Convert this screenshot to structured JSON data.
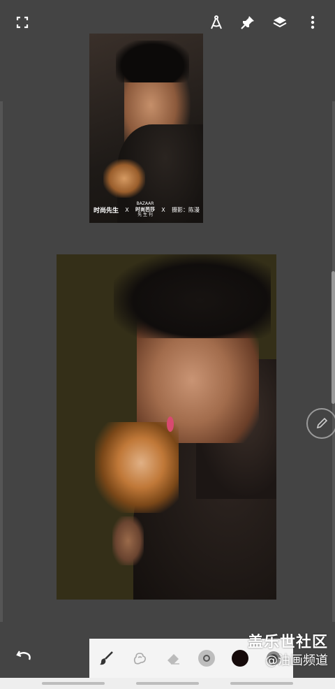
{
  "app": {
    "bg_color": "#444444"
  },
  "top_toolbar": {
    "icons": [
      "fullscreen-icon",
      "compass-icon",
      "pin-icon",
      "layers-icon",
      "more-icon"
    ]
  },
  "reference_image": {
    "caption_left": "时尚先生",
    "caption_x1": "X",
    "caption_mid_top": "BAZAAR",
    "caption_mid": "时尚芭莎",
    "caption_mid_sub": "先 生 刊",
    "caption_x2": "X",
    "caption_right": "摄影：陈漫"
  },
  "bottom_toolbar": {
    "tools": [
      "brush-icon",
      "smudge-icon",
      "eraser-icon",
      "brush-size-icon"
    ],
    "current_color": "#160b0b",
    "opacity_icon": "opacity-icon"
  },
  "watermark": {
    "line1": "盖乐世社区",
    "line2": "@油画频道"
  }
}
